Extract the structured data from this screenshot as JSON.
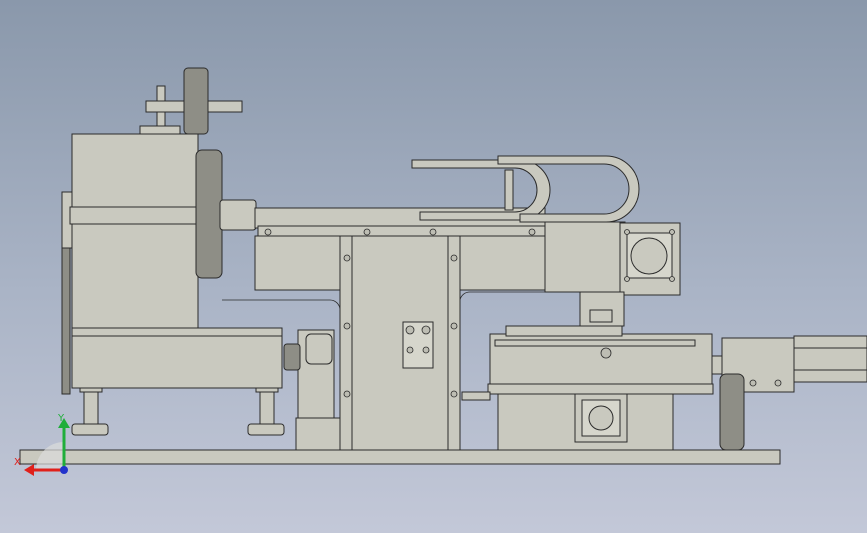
{
  "triad": {
    "y_label": "Y",
    "x_label": "X",
    "colors": {
      "y": "#1fae3a",
      "x": "#e0201b",
      "z": "#2233cc"
    }
  },
  "colors": {
    "background_top": "#8a98ab",
    "background_bottom": "#c3c8d8",
    "part_fill": "#c9c9bf",
    "edge": "#2b2b2b"
  }
}
